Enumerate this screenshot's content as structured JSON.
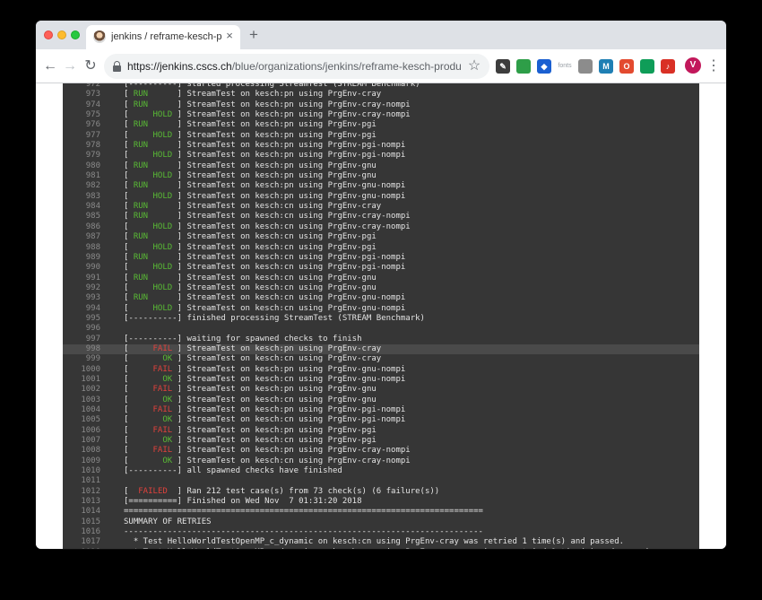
{
  "browser": {
    "tab_title": "jenkins / reframe-kesch-production",
    "tab_close": "×",
    "new_tab": "+",
    "url_host": "https://jenkins.cscs.ch",
    "url_path": "/blue/organizations/jenkins/reframe-kesch-production-d...",
    "avatar_letter": "V",
    "extensions": [
      {
        "name": "pen-extension-icon",
        "label": "✎",
        "color": "#3d3d3d"
      },
      {
        "name": "green-square-extension-icon",
        "label": "",
        "color": "#2e9e48"
      },
      {
        "name": "blue-stack-extension-icon",
        "label": "◆",
        "color": "#1a5fd1"
      },
      {
        "name": "fonts-extension-icon",
        "label": "fonts",
        "color": "#9aa0a6"
      },
      {
        "name": "grey-circle-extension-icon",
        "label": "",
        "color": "#8c8c8c"
      },
      {
        "name": "m-extension-icon",
        "label": "M",
        "color": "#1f7fb4"
      },
      {
        "name": "red-circle-extension-icon",
        "label": "O",
        "color": "#e34a2f"
      },
      {
        "name": "green-circle-extension-icon",
        "label": "",
        "color": "#0f9d58"
      },
      {
        "name": "music-extension-icon",
        "label": "♪",
        "color": "#d93025"
      }
    ]
  },
  "log": {
    "lines": [
      {
        "n": "972",
        "p": "[----------]",
        "s": "",
        "t": " started processing StreamTest (STREAM Benchmark)"
      },
      {
        "n": "973",
        "p": "[ ",
        "s": "RUN",
        "k": "run",
        "q": "      ]",
        "t": " StreamTest on kesch:pn using PrgEnv-cray"
      },
      {
        "n": "974",
        "p": "[ ",
        "s": "RUN",
        "k": "run",
        "q": "      ]",
        "t": " StreamTest on kesch:pn using PrgEnv-cray-nompi"
      },
      {
        "n": "975",
        "p": "[     ",
        "s": "HOLD",
        "k": "hold",
        "q": " ]",
        "t": " StreamTest on kesch:pn using PrgEnv-cray-nompi"
      },
      {
        "n": "976",
        "p": "[ ",
        "s": "RUN",
        "k": "run",
        "q": "      ]",
        "t": " StreamTest on kesch:pn using PrgEnv-pgi"
      },
      {
        "n": "977",
        "p": "[     ",
        "s": "HOLD",
        "k": "hold",
        "q": " ]",
        "t": " StreamTest on kesch:pn using PrgEnv-pgi"
      },
      {
        "n": "978",
        "p": "[ ",
        "s": "RUN",
        "k": "run",
        "q": "      ]",
        "t": " StreamTest on kesch:pn using PrgEnv-pgi-nompi"
      },
      {
        "n": "979",
        "p": "[     ",
        "s": "HOLD",
        "k": "hold",
        "q": " ]",
        "t": " StreamTest on kesch:pn using PrgEnv-pgi-nompi"
      },
      {
        "n": "980",
        "p": "[ ",
        "s": "RUN",
        "k": "run",
        "q": "      ]",
        "t": " StreamTest on kesch:pn using PrgEnv-gnu"
      },
      {
        "n": "981",
        "p": "[     ",
        "s": "HOLD",
        "k": "hold",
        "q": " ]",
        "t": " StreamTest on kesch:pn using PrgEnv-gnu"
      },
      {
        "n": "982",
        "p": "[ ",
        "s": "RUN",
        "k": "run",
        "q": "      ]",
        "t": " StreamTest on kesch:pn using PrgEnv-gnu-nompi"
      },
      {
        "n": "983",
        "p": "[     ",
        "s": "HOLD",
        "k": "hold",
        "q": " ]",
        "t": " StreamTest on kesch:pn using PrgEnv-gnu-nompi"
      },
      {
        "n": "984",
        "p": "[ ",
        "s": "RUN",
        "k": "run",
        "q": "      ]",
        "t": " StreamTest on kesch:cn using PrgEnv-cray"
      },
      {
        "n": "985",
        "p": "[ ",
        "s": "RUN",
        "k": "run",
        "q": "      ]",
        "t": " StreamTest on kesch:cn using PrgEnv-cray-nompi"
      },
      {
        "n": "986",
        "p": "[     ",
        "s": "HOLD",
        "k": "hold",
        "q": " ]",
        "t": " StreamTest on kesch:cn using PrgEnv-cray-nompi"
      },
      {
        "n": "987",
        "p": "[ ",
        "s": "RUN",
        "k": "run",
        "q": "      ]",
        "t": " StreamTest on kesch:cn using PrgEnv-pgi"
      },
      {
        "n": "988",
        "p": "[     ",
        "s": "HOLD",
        "k": "hold",
        "q": " ]",
        "t": " StreamTest on kesch:cn using PrgEnv-pgi"
      },
      {
        "n": "989",
        "p": "[ ",
        "s": "RUN",
        "k": "run",
        "q": "      ]",
        "t": " StreamTest on kesch:cn using PrgEnv-pgi-nompi"
      },
      {
        "n": "990",
        "p": "[     ",
        "s": "HOLD",
        "k": "hold",
        "q": " ]",
        "t": " StreamTest on kesch:cn using PrgEnv-pgi-nompi"
      },
      {
        "n": "991",
        "p": "[ ",
        "s": "RUN",
        "k": "run",
        "q": "      ]",
        "t": " StreamTest on kesch:cn using PrgEnv-gnu"
      },
      {
        "n": "992",
        "p": "[     ",
        "s": "HOLD",
        "k": "hold",
        "q": " ]",
        "t": " StreamTest on kesch:cn using PrgEnv-gnu"
      },
      {
        "n": "993",
        "p": "[ ",
        "s": "RUN",
        "k": "run",
        "q": "      ]",
        "t": " StreamTest on kesch:cn using PrgEnv-gnu-nompi"
      },
      {
        "n": "994",
        "p": "[     ",
        "s": "HOLD",
        "k": "hold",
        "q": " ]",
        "t": " StreamTest on kesch:cn using PrgEnv-gnu-nompi"
      },
      {
        "n": "995",
        "p": "[----------]",
        "s": "",
        "t": " finished processing StreamTest (STREAM Benchmark)"
      },
      {
        "n": "996",
        "p": "",
        "s": "",
        "t": ""
      },
      {
        "n": "997",
        "p": "[----------]",
        "s": "",
        "t": " waiting for spawned checks to finish"
      },
      {
        "n": "998",
        "p": "[     ",
        "s": "FAIL",
        "k": "fail",
        "q": " ]",
        "t": " StreamTest on kesch:pn using PrgEnv-cray",
        "hl": true
      },
      {
        "n": "999",
        "p": "[       ",
        "s": "OK",
        "k": "ok",
        "q": " ]",
        "t": " StreamTest on kesch:cn using PrgEnv-cray"
      },
      {
        "n": "1000",
        "p": "[     ",
        "s": "FAIL",
        "k": "fail",
        "q": " ]",
        "t": " StreamTest on kesch:pn using PrgEnv-gnu-nompi"
      },
      {
        "n": "1001",
        "p": "[       ",
        "s": "OK",
        "k": "ok",
        "q": " ]",
        "t": " StreamTest on kesch:cn using PrgEnv-gnu-nompi"
      },
      {
        "n": "1002",
        "p": "[     ",
        "s": "FAIL",
        "k": "fail",
        "q": " ]",
        "t": " StreamTest on kesch:pn using PrgEnv-gnu"
      },
      {
        "n": "1003",
        "p": "[       ",
        "s": "OK",
        "k": "ok",
        "q": " ]",
        "t": " StreamTest on kesch:cn using PrgEnv-gnu"
      },
      {
        "n": "1004",
        "p": "[     ",
        "s": "FAIL",
        "k": "fail",
        "q": " ]",
        "t": " StreamTest on kesch:pn using PrgEnv-pgi-nompi"
      },
      {
        "n": "1005",
        "p": "[       ",
        "s": "OK",
        "k": "ok",
        "q": " ]",
        "t": " StreamTest on kesch:cn using PrgEnv-pgi-nompi"
      },
      {
        "n": "1006",
        "p": "[     ",
        "s": "FAIL",
        "k": "fail",
        "q": " ]",
        "t": " StreamTest on kesch:pn using PrgEnv-pgi"
      },
      {
        "n": "1007",
        "p": "[       ",
        "s": "OK",
        "k": "ok",
        "q": " ]",
        "t": " StreamTest on kesch:cn using PrgEnv-pgi"
      },
      {
        "n": "1008",
        "p": "[     ",
        "s": "FAIL",
        "k": "fail",
        "q": " ]",
        "t": " StreamTest on kesch:pn using PrgEnv-cray-nompi"
      },
      {
        "n": "1009",
        "p": "[       ",
        "s": "OK",
        "k": "ok",
        "q": " ]",
        "t": " StreamTest on kesch:cn using PrgEnv-cray-nompi"
      },
      {
        "n": "1010",
        "p": "[----------]",
        "s": "",
        "t": " all spawned checks have finished"
      },
      {
        "n": "1011",
        "p": "",
        "s": "",
        "t": ""
      },
      {
        "n": "1012",
        "p": "[  ",
        "s": "FAILED",
        "k": "fail",
        "q": "  ]",
        "t": " Ran 212 test case(s) from 73 check(s) (6 failure(s))"
      },
      {
        "n": "1013",
        "p": "[==========]",
        "s": "",
        "t": " Finished on Wed Nov  7 01:31:20 2018"
      },
      {
        "n": "1014",
        "p": "==========================================================================",
        "s": "",
        "t": ""
      },
      {
        "n": "1015",
        "p": "SUMMARY OF RETRIES",
        "s": "",
        "t": ""
      },
      {
        "n": "1016",
        "p": "--------------------------------------------------------------------------",
        "s": "",
        "t": ""
      },
      {
        "n": "1017",
        "p": "  * Test HelloWorldTestOpenMP_c_dynamic on kesch:cn using PrgEnv-cray was retried 1 time(s) and passed.",
        "s": "",
        "t": ""
      },
      {
        "n": "1018",
        "p": "  * Test HelloWorldTestOpenMP_c_dynamic on kesch:cn using PrgEnv-cray-nompi was retried 1 time(s) and passed.",
        "s": "",
        "t": ""
      }
    ]
  }
}
